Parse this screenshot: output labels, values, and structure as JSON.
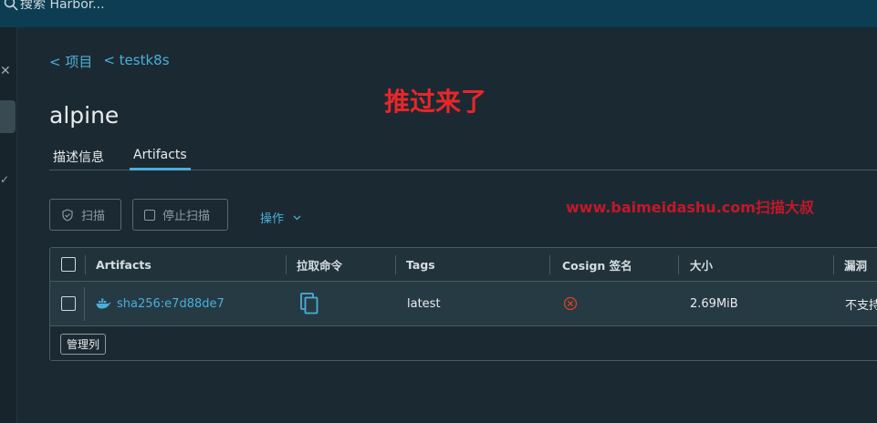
{
  "header": {
    "search_placeholder": "搜索 Harbor..."
  },
  "breadcrumb": [
    "< 项目",
    "< testk8s"
  ],
  "page_title": "alpine",
  "annotation": "推过来了",
  "watermark": "www.baimeidashu.com扫描大叔",
  "tabs": [
    {
      "label": "描述信息",
      "active": false
    },
    {
      "label": "Artifacts",
      "active": true
    }
  ],
  "toolbar": {
    "scan_label": "扫描",
    "stop_scan_label": "停止扫描",
    "actions_label": "操作"
  },
  "table": {
    "columns": [
      "Artifacts",
      "拉取命令",
      "Tags",
      "Cosign 签名",
      "大小",
      "漏洞"
    ],
    "rows": [
      {
        "digest": "sha256:e7d88de7",
        "tag": "latest",
        "cosign_status": "unsigned",
        "size": "2.69MiB",
        "vulnerabilities": "不支持"
      }
    ],
    "manage_columns_label": "管理列"
  },
  "colors": {
    "accent": "#4aaed9",
    "header_bg": "#0c3d53",
    "page_bg": "#1b2a32",
    "error": "#e0401e",
    "annotation": "#e8262a"
  },
  "icons": {
    "search": "search-icon",
    "scan": "shield-icon",
    "copy": "copy-icon",
    "docker": "docker-icon",
    "cosign_status": "x-circle-icon",
    "chevron": "chevron-down-icon"
  }
}
